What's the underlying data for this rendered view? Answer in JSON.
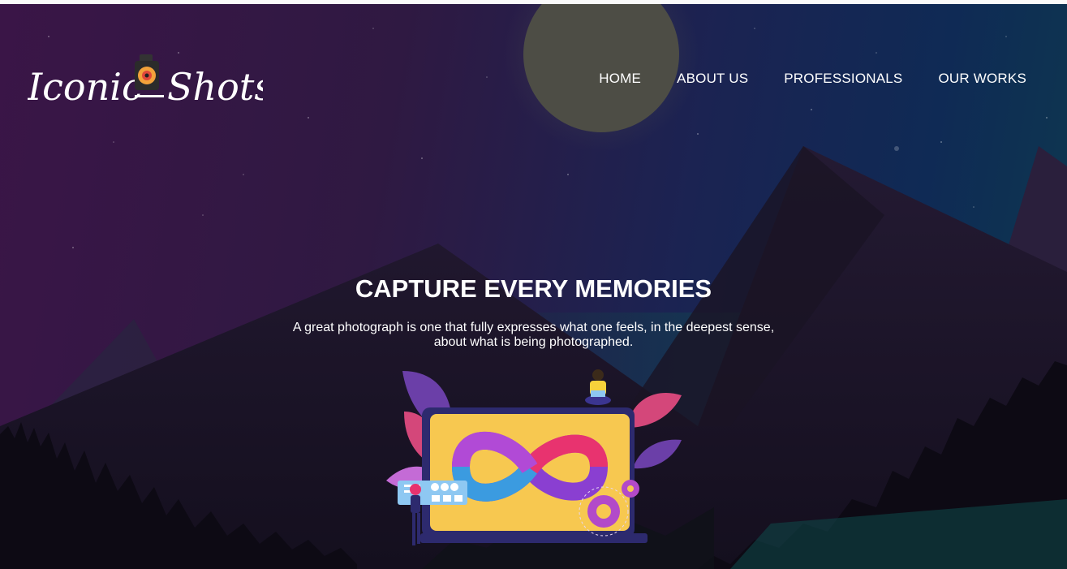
{
  "brand": {
    "name_part1": "Iconic",
    "name_part2": "Shots",
    "icon": "camera-lens-icon"
  },
  "nav": {
    "items": [
      {
        "label": "HOME"
      },
      {
        "label": "ABOUT US"
      },
      {
        "label": "PROFESSIONALS"
      },
      {
        "label": "OUR WORKS"
      }
    ]
  },
  "hero": {
    "title": "CAPTURE EVERY MEMORIES",
    "subtitle": "A great photograph is one that fully expresses what one feels, in the deepest sense, about what is being photographed."
  },
  "colors": {
    "sky_left": "#3a1547",
    "sky_right": "#0f2a55",
    "moon": "#4d4d45",
    "mountain": "#1c1428",
    "teal_glow": "#0f5a55",
    "laptop_screen": "#f7c850",
    "infinity_pink": "#e8336f",
    "infinity_purple": "#8a3fd1",
    "infinity_blue": "#3b9be0"
  }
}
